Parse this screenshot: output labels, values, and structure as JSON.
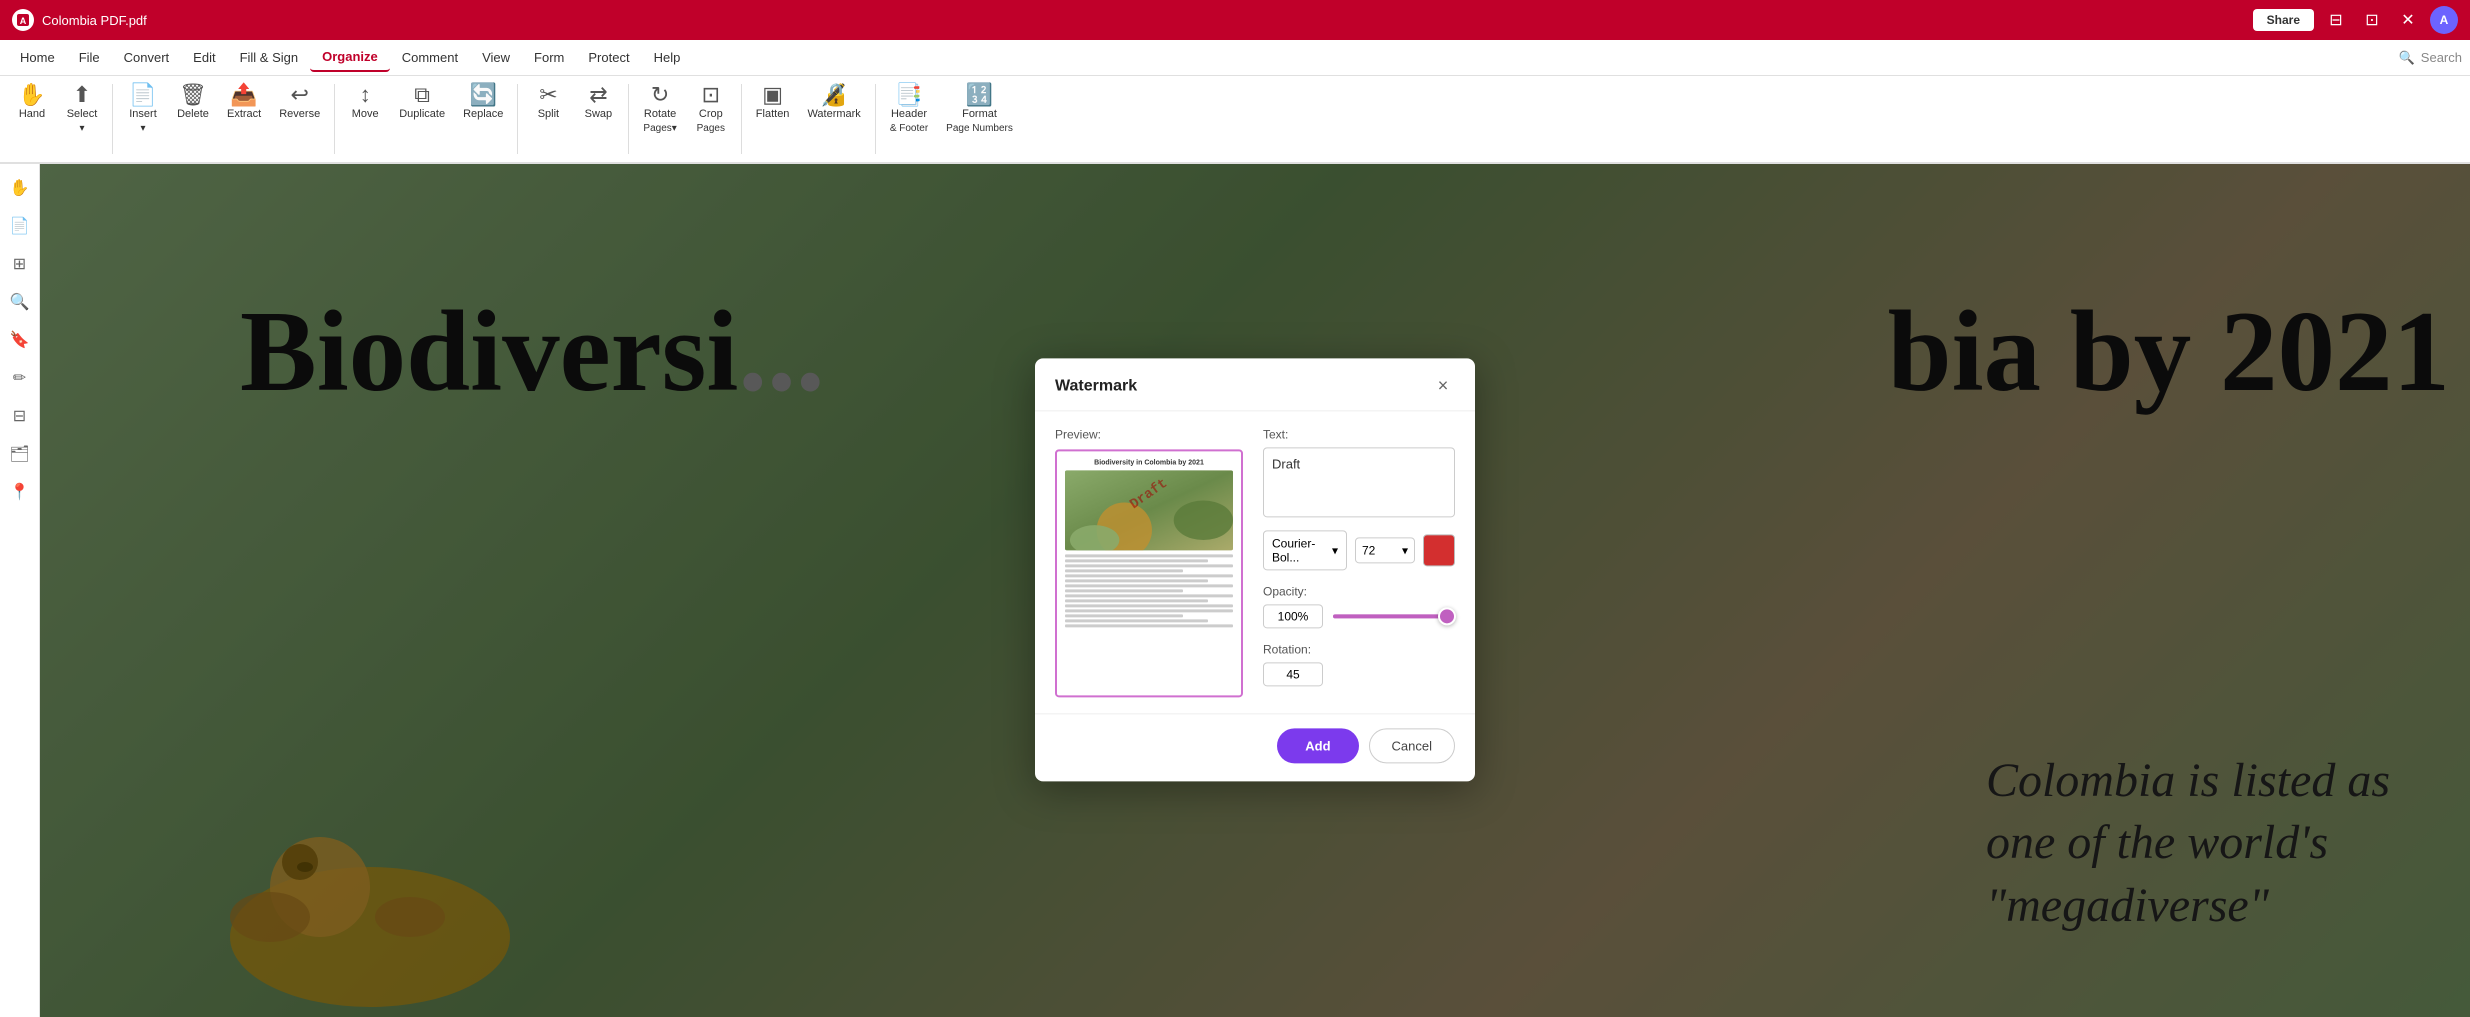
{
  "titleBar": {
    "appName": "Colombia PDF.pdf",
    "shareLabel": "Share",
    "logoColor": "#c0002a"
  },
  "menuBar": {
    "items": [
      {
        "label": "Home",
        "active": false
      },
      {
        "label": "File",
        "active": false
      },
      {
        "label": "Convert",
        "active": false
      },
      {
        "label": "Edit",
        "active": false
      },
      {
        "label": "Fill & Sign",
        "active": false
      },
      {
        "label": "Organize",
        "active": true
      },
      {
        "label": "Comment",
        "active": false
      },
      {
        "label": "View",
        "active": false
      },
      {
        "label": "Form",
        "active": false
      },
      {
        "label": "Protect",
        "active": false
      },
      {
        "label": "Help",
        "active": false
      }
    ],
    "searchPlaceholder": "Search"
  },
  "ribbon": {
    "buttons": [
      {
        "label": "Hand",
        "icon": "✋",
        "sublabel": ""
      },
      {
        "label": "Select",
        "icon": "⬆",
        "sublabel": ""
      },
      {
        "label": "Insert",
        "icon": "📄",
        "sublabel": ""
      },
      {
        "label": "Delete",
        "icon": "🗑",
        "sublabel": ""
      },
      {
        "label": "Extract",
        "icon": "📤",
        "sublabel": ""
      },
      {
        "label": "Reverse",
        "icon": "↩",
        "sublabel": ""
      },
      {
        "label": "Move",
        "icon": "↕",
        "sublabel": ""
      },
      {
        "label": "Duplicate",
        "icon": "⧉",
        "sublabel": ""
      },
      {
        "label": "Replace",
        "icon": "🔄",
        "sublabel": ""
      },
      {
        "label": "Split",
        "icon": "✂",
        "sublabel": ""
      },
      {
        "label": "Swap",
        "icon": "⇄",
        "sublabel": ""
      },
      {
        "label": "Rotate Pages",
        "icon": "↻",
        "sublabel": ""
      },
      {
        "label": "Crop Pages",
        "icon": "⊡",
        "sublabel": ""
      },
      {
        "label": "Flatten",
        "icon": "▣",
        "sublabel": ""
      },
      {
        "label": "Watermark",
        "icon": "🔏",
        "sublabel": ""
      },
      {
        "label": "Header & Footer",
        "icon": "📑",
        "sublabel": ""
      },
      {
        "label": "Format Page Numbers",
        "icon": "🔢",
        "sublabel": ""
      }
    ]
  },
  "dialog": {
    "title": "Watermark",
    "closeLabel": "×",
    "previewLabel": "Preview:",
    "textLabel": "Text:",
    "textValue": "Draft",
    "fontValue": "Courier-Bol...",
    "fontSizeValue": "72",
    "opacityLabel": "Opacity:",
    "opacityValue": "100%",
    "rotationLabel": "Rotation:",
    "rotationValue": "45",
    "addLabel": "Add",
    "cancelLabel": "Cancel",
    "colorHex": "#d32f2f"
  },
  "pdfContent": {
    "title": "Biodiversity in Colombia by 2021",
    "bigTitle": "Biodiversi",
    "bigTitle2": "bia by 2021",
    "sideText": "Colombia is listed as one of the world's \"megadiverse\""
  }
}
